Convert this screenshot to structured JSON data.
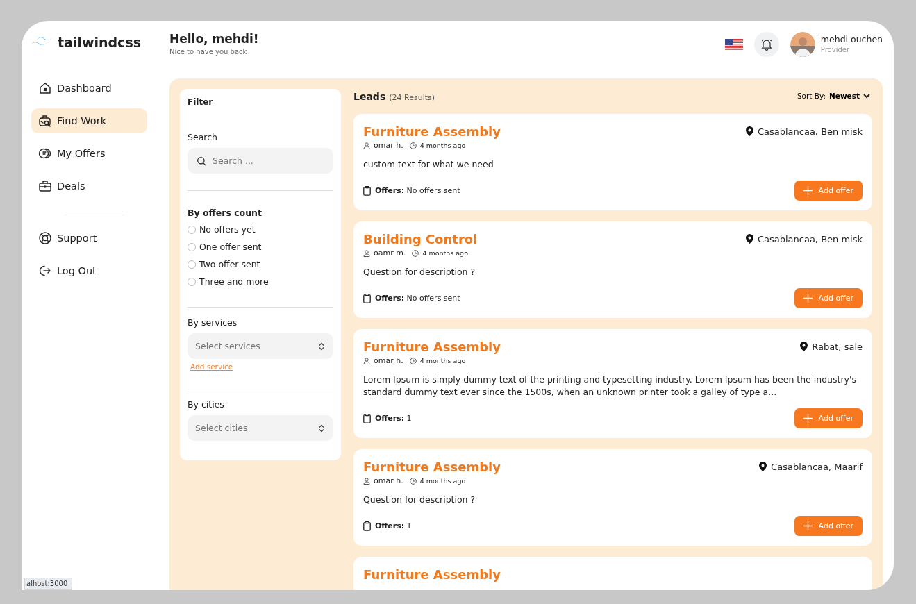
{
  "logo": {
    "text": "tailwindcss"
  },
  "header": {
    "greeting": "Hello, mehdi!",
    "subtitle": "Nice to have you back"
  },
  "user": {
    "name": "mehdi ouchen",
    "role": "Provider"
  },
  "sidebar": {
    "items": [
      {
        "label": "Dashboard",
        "selected": false
      },
      {
        "label": "Find Work",
        "selected": true
      },
      {
        "label": "My Offers",
        "selected": false
      },
      {
        "label": "Deals",
        "selected": false
      }
    ],
    "bottom_items": [
      {
        "label": "Support",
        "selected": false
      },
      {
        "label": "Log Out",
        "selected": false
      }
    ]
  },
  "filter": {
    "title": "Filter",
    "search": {
      "label": "Search",
      "placeholder": "Search ..."
    },
    "offers_count": {
      "title": "By offers count",
      "options": [
        {
          "label": "No offers yet",
          "selected": false
        },
        {
          "label": "One offer sent",
          "selected": false
        },
        {
          "label": "Two offer sent",
          "selected": false
        },
        {
          "label": "Three and more",
          "selected": false
        }
      ]
    },
    "services": {
      "label": "By services",
      "placeholder": "Select services",
      "link": "Add service"
    },
    "cities": {
      "label": "By cities",
      "placeholder": "Select cities"
    }
  },
  "leads": {
    "title": "Leads",
    "count": "(24 Results)",
    "sort_label": "Sort By:",
    "sort_value": "Newest",
    "items": [
      {
        "title": "Furniture Assembly",
        "author": "omar h.",
        "time": "4 months ago",
        "location": "Casablancaa, Ben misk",
        "description": "custom text for what we need",
        "offers_label": "Offers:",
        "offers_value": "No offers sent",
        "button": "Add offer"
      },
      {
        "title": "Building Control",
        "author": "oamr m.",
        "time": "4 months ago",
        "location": "Casablancaa, Ben misk",
        "description": "Question for description ?",
        "offers_label": "Offers:",
        "offers_value": "No offers sent",
        "button": "Add offer"
      },
      {
        "title": "Furniture Assembly",
        "author": "omar h.",
        "time": "4 months ago",
        "location": "Rabat, sale",
        "description": "Lorem Ipsum is simply dummy text of the printing and typesetting industry. Lorem Ipsum has been the industry's standard dummy text ever since the 1500s, when an unknown printer took a galley of type a...",
        "offers_label": "Offers:",
        "offers_value": "1",
        "button": "Add offer"
      },
      {
        "title": "Furniture Assembly",
        "author": "omar h.",
        "time": "4 months ago",
        "location": "Casablancaa, Maarif",
        "description": "Question for description ?",
        "offers_label": "Offers:",
        "offers_value": "1",
        "button": "Add offer"
      }
    ],
    "partial_item": {
      "title": "Furniture Assembly"
    }
  },
  "status_bar": {
    "url": "alhost:3000"
  }
}
